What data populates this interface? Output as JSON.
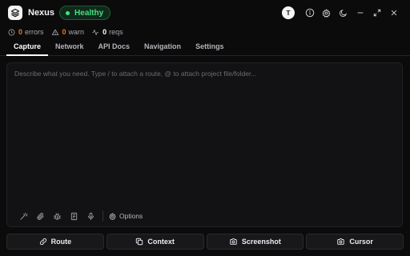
{
  "app": {
    "name": "Nexus",
    "health_label": "Healthy",
    "avatar_initial": "T"
  },
  "status": {
    "errors_count": "0",
    "errors_label": "errors",
    "warn_count": "0",
    "warn_label": "warn",
    "reqs_count": "0",
    "reqs_label": "reqs"
  },
  "tabs": [
    {
      "label": "Capture",
      "active": true
    },
    {
      "label": "Network"
    },
    {
      "label": "API Docs"
    },
    {
      "label": "Navigation"
    },
    {
      "label": "Settings"
    }
  ],
  "editor": {
    "placeholder": "Describe what you need. Type / to attach a route, @ to attach project file/folder...",
    "options_label": "Options"
  },
  "actions": {
    "route": "Route",
    "context": "Context",
    "screenshot": "Screenshot",
    "cursor": "Cursor"
  },
  "colors": {
    "background": "#0b0b0c",
    "health_green": "#4ade80",
    "count_orange": "#f97316"
  },
  "icons": [
    "layers-icon",
    "info-icon",
    "gear-icon",
    "moon-icon",
    "minimize-icon",
    "expand-icon",
    "close-icon",
    "clock-icon",
    "warning-icon",
    "activity-icon",
    "wand-icon",
    "paperclip-icon",
    "bug-icon",
    "document-icon",
    "microphone-icon",
    "link-icon",
    "copy-icon",
    "camera-icon"
  ]
}
